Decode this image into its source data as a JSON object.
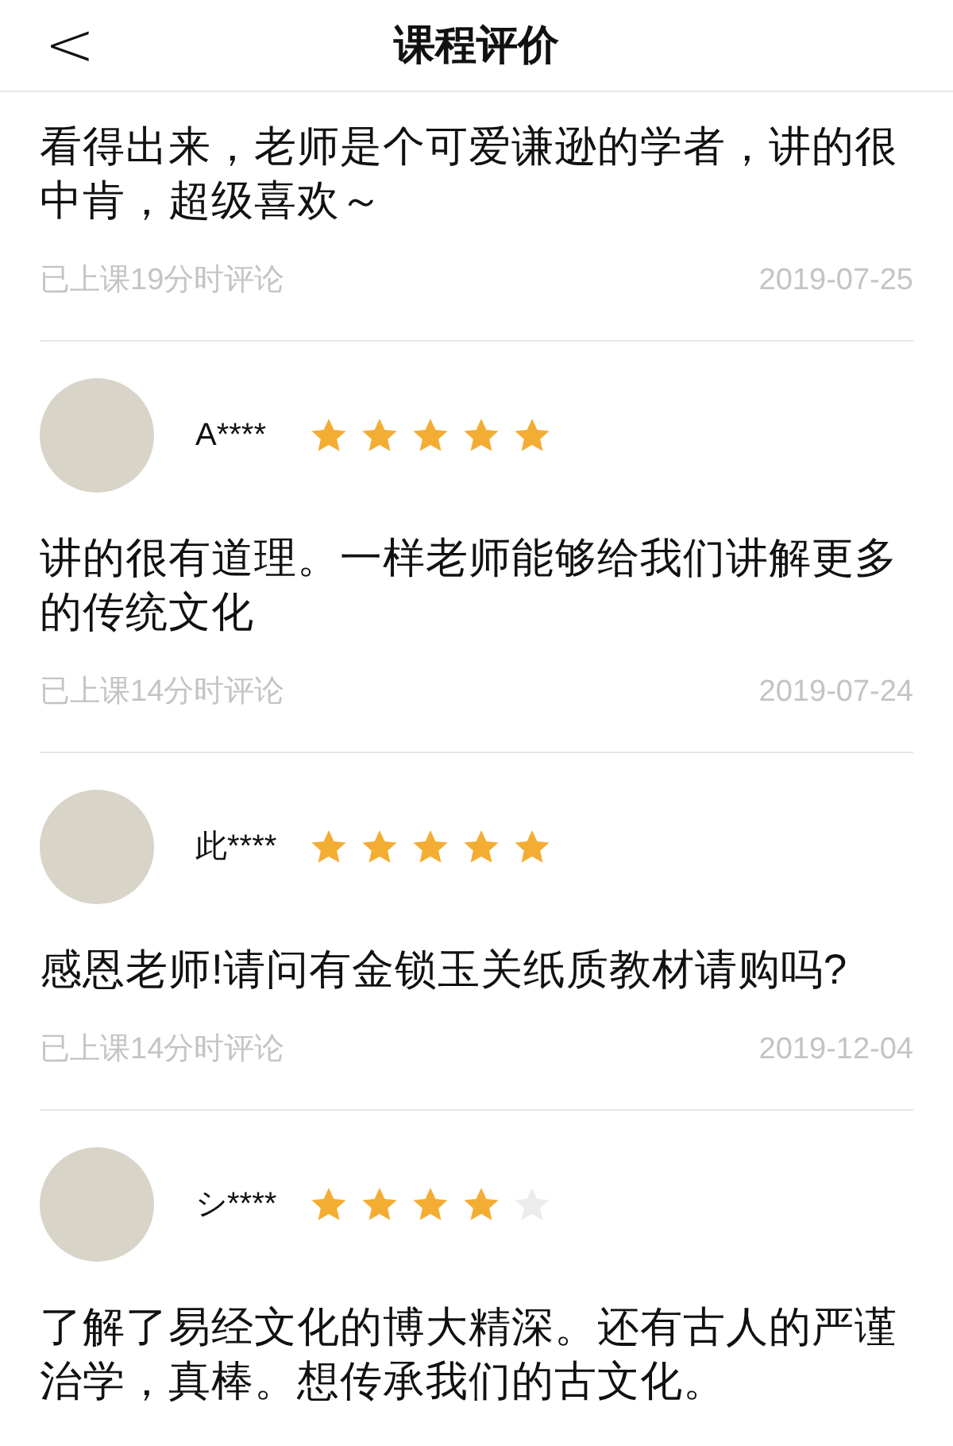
{
  "header": {
    "back_icon": "<",
    "title": "课程评价"
  },
  "reviews": [
    {
      "text": "看得出来，老师是个可爱谦逊的学者，讲的很中肯，超级喜欢～",
      "meta": "已上课19分时评论",
      "date": "2019-07-25"
    },
    {
      "user": "A****",
      "stars": 5,
      "text": "讲的很有道理。一样老师能够给我们讲解更多的传统文化",
      "meta": "已上课14分时评论",
      "date": "2019-07-24"
    },
    {
      "user": "此****",
      "stars": 5,
      "text": "感恩老师!请问有金锁玉关纸质教材请购吗?",
      "meta": "已上课14分时评论",
      "date": "2019-12-04"
    },
    {
      "user": "シ****",
      "stars": 4,
      "text": "了解了易经文化的博大精深。还有古人的严谨治学，真棒。想传承我们的古文化。"
    }
  ]
}
